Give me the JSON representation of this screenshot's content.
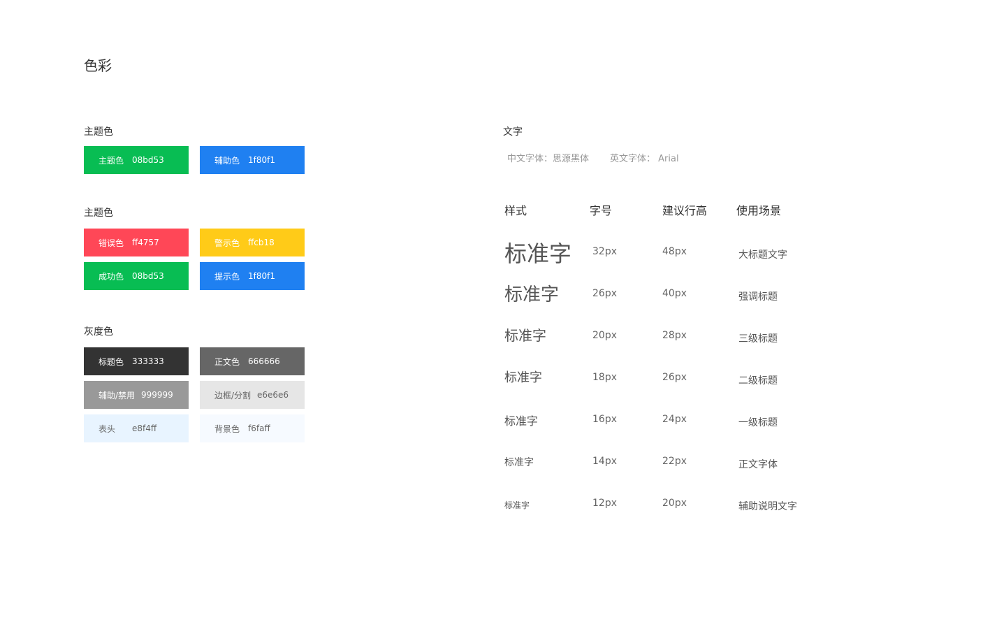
{
  "page_title": "色彩",
  "colors": {
    "theme_label": "主题色",
    "theme": [
      {
        "name": "主题色",
        "hex": "08bd53",
        "bg": "#08bd53",
        "fg": "#ffffff"
      },
      {
        "name": "辅助色",
        "hex": "1f80f1",
        "bg": "#1f80f1",
        "fg": "#ffffff"
      }
    ],
    "status_label": "主题色",
    "status": [
      {
        "name": "错误色",
        "hex": "ff4757",
        "bg": "#ff4757",
        "fg": "#ffffff"
      },
      {
        "name": "警示色",
        "hex": "ffcb18",
        "bg": "#ffcb18",
        "fg": "#ffffff"
      },
      {
        "name": "成功色",
        "hex": "08bd53",
        "bg": "#08bd53",
        "fg": "#ffffff"
      },
      {
        "name": "提示色",
        "hex": "1f80f1",
        "bg": "#1f80f1",
        "fg": "#ffffff"
      }
    ],
    "gray_label": "灰度色",
    "gray": [
      {
        "name": "标题色",
        "hex": "333333",
        "bg": "#333333",
        "fg": "#ffffff"
      },
      {
        "name": "正文色",
        "hex": "666666",
        "bg": "#666666",
        "fg": "#ffffff"
      },
      {
        "name": "辅助/禁用",
        "hex": "999999",
        "bg": "#999999",
        "fg": "#ffffff"
      },
      {
        "name": "边框/分割",
        "hex": "e6e6e6",
        "bg": "#e6e6e6",
        "fg": "#666666"
      },
      {
        "name": "表头",
        "hex": "e8f4ff",
        "bg": "#e8f4ff",
        "fg": "#666666"
      },
      {
        "name": "背景色",
        "hex": "f6faff",
        "bg": "#f6faff",
        "fg": "#666666"
      }
    ]
  },
  "typography": {
    "title": "文字",
    "cn_font": "中文字体：思源黑体",
    "en_font": "英文字体：  Arial",
    "headers": {
      "style": "样式",
      "size": "字号",
      "line_height": "建议行高",
      "usage": "使用场景"
    },
    "rows": [
      {
        "sample": "标准字",
        "size": "32px",
        "line_height": "48px",
        "usage": "大标题文字"
      },
      {
        "sample": "标准字",
        "size": "26px",
        "line_height": "40px",
        "usage": "强调标题"
      },
      {
        "sample": "标准字",
        "size": "20px",
        "line_height": "28px",
        "usage": "三级标题"
      },
      {
        "sample": "标准字",
        "size": "18px",
        "line_height": "26px",
        "usage": "二级标题"
      },
      {
        "sample": "标准字",
        "size": "16px",
        "line_height": "24px",
        "usage": "一级标题"
      },
      {
        "sample": "标准字",
        "size": "14px",
        "line_height": "22px",
        "usage": "正文字体"
      },
      {
        "sample": "标准字",
        "size": "12px",
        "line_height": "20px",
        "usage": "辅助说明文字"
      }
    ]
  }
}
